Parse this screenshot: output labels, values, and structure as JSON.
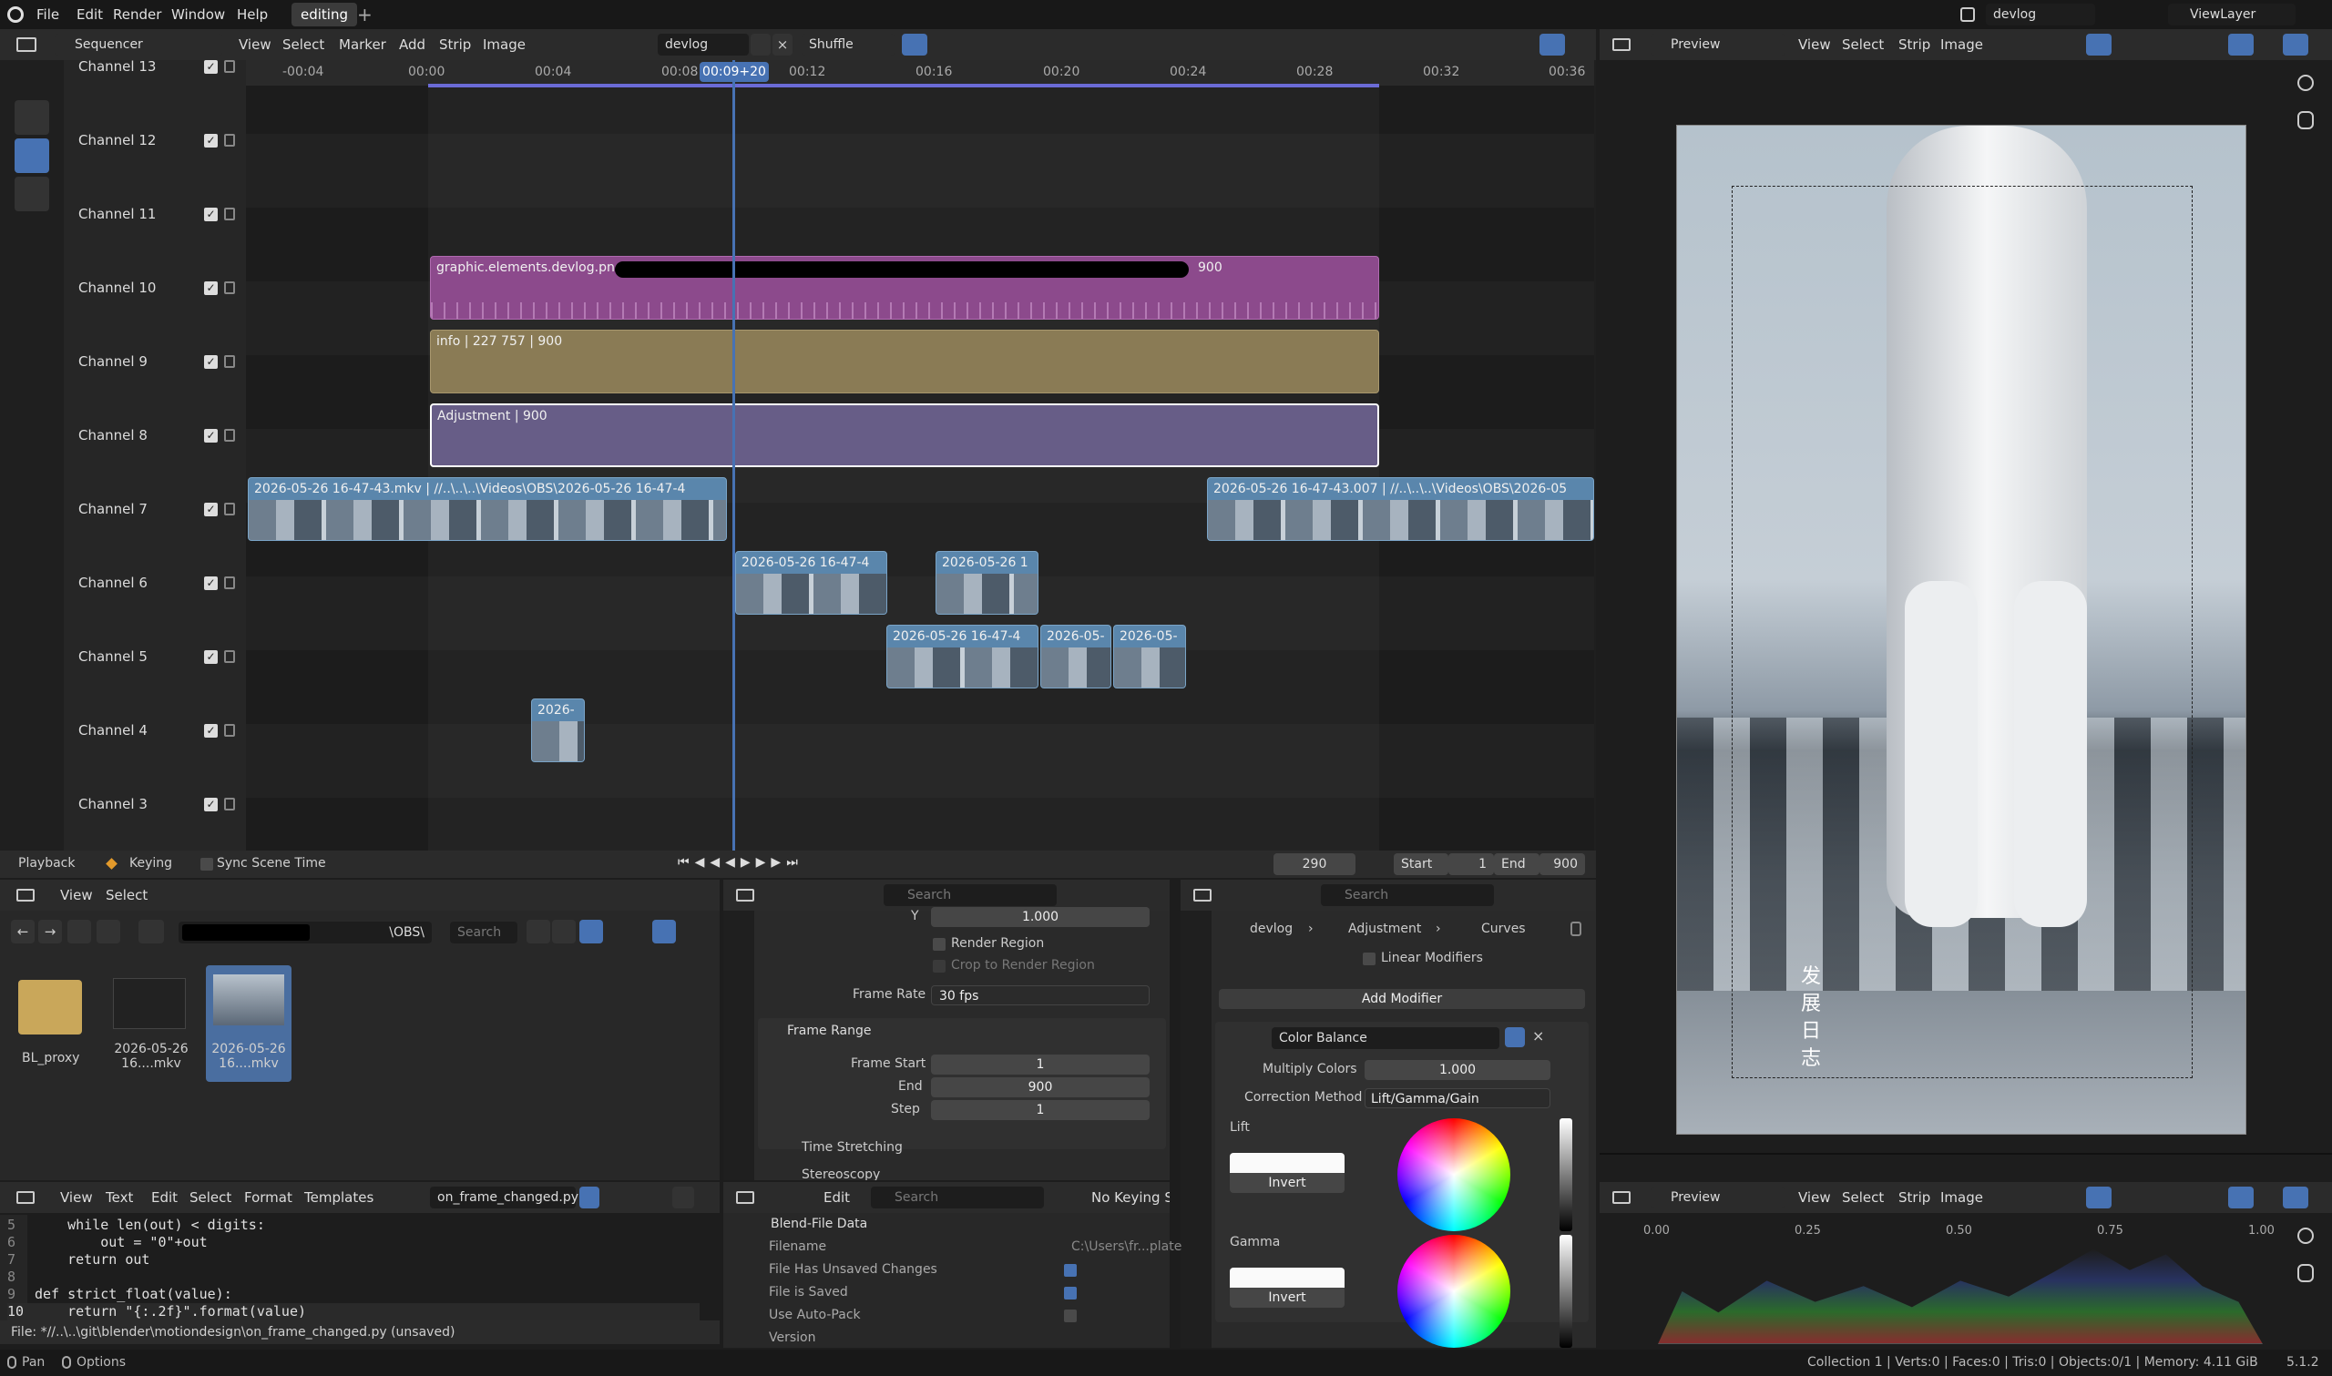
{
  "topbar": {
    "menus": [
      "File",
      "Edit",
      "Render",
      "Window",
      "Help"
    ],
    "workspace_tab": "editing",
    "scene_name": "devlog",
    "view_layer": "ViewLayer"
  },
  "sequencer": {
    "editor_type": "Sequencer",
    "menus": [
      "View",
      "Select",
      "Marker",
      "Add",
      "Strip",
      "Image"
    ],
    "scene": "devlog",
    "overlap_mode": "Shuffle",
    "current_time": "00:09+20",
    "ruler_labels": [
      "-00:04",
      "00:00",
      "00:04",
      "00:08",
      "00:12",
      "00:16",
      "00:20",
      "00:24",
      "00:28",
      "00:32",
      "00:36"
    ],
    "channels": [
      "Channel 13",
      "Channel 12",
      "Channel 11",
      "Channel 10",
      "Channel 9",
      "Channel 8",
      "Channel 7",
      "Channel 6",
      "Channel 5",
      "Channel 4",
      "Channel 3"
    ],
    "strips": {
      "image": {
        "name": "graphic.elements.devlog.png",
        "length": "900"
      },
      "info": "info | 227 757 | 900",
      "adjustment": "Adjustment | 900",
      "ch7_a": "2026-05-26 16-47-43.mkv | //..\\..\\..\\Videos\\OBS\\2026-05-26 16-47-4",
      "ch7_b": "2026-05-26 16-47-43.007 | //..\\..\\..\\Videos\\OBS\\2026-05",
      "ch6_a": "2026-05-26 16-47-4",
      "ch6_b": "2026-05-26 1",
      "ch5_a": "2026-05-26 16-47-4",
      "ch5_b": "2026-05-",
      "ch5_c": "2026-05-",
      "ch4": "2026-"
    }
  },
  "playback": {
    "playback_label": "Playback",
    "keying_label": "Keying",
    "sync_label": "Sync Scene Time",
    "frame": "290",
    "start_label": "Start",
    "start": "1",
    "end_label": "End",
    "end": "900"
  },
  "filebrowser": {
    "menus": [
      "View",
      "Select"
    ],
    "path": "\\OBS\\",
    "search_placeholder": "Search",
    "items": [
      {
        "name": "BL_proxy"
      },
      {
        "name": "2026-05-26 16....mkv"
      },
      {
        "name": "2026-05-26 16....mkv"
      }
    ]
  },
  "output_props": {
    "search_placeholder": "Search",
    "y_label": "Y",
    "y_value": "1.000",
    "render_region": "Render Region",
    "crop_region": "Crop to Render Region",
    "frame_rate_label": "Frame Rate",
    "frame_rate": "30 fps",
    "frame_range_title": "Frame Range",
    "frame_start_label": "Frame Start",
    "frame_start": "1",
    "end_label": "End",
    "end": "900",
    "step_label": "Step",
    "step": "1",
    "time_stretching": "Time Stretching",
    "stereoscopy": "Stereoscopy"
  },
  "modifier_props": {
    "search_placeholder": "Search",
    "breadcrumb": [
      "devlog",
      "Adjustment",
      "Curves"
    ],
    "linear_modifiers": "Linear Modifiers",
    "add_modifier": "Add Modifier",
    "modifier_name": "Color Balance",
    "multiply_colors_label": "Multiply Colors",
    "multiply_colors": "1.000",
    "correction_method_label": "Correction Method",
    "correction_method": "Lift/Gamma/Gain",
    "lift_label": "Lift",
    "gamma_label": "Gamma",
    "invert_label": "Invert"
  },
  "preview": {
    "editor_label": "Preview",
    "menus": [
      "View",
      "Select",
      "Strip",
      "Image"
    ],
    "vertical_text": "发展日志"
  },
  "histogram": {
    "editor_label": "Preview",
    "menus": [
      "View",
      "Select",
      "Strip",
      "Image"
    ],
    "axis_labels": [
      "0.00",
      "0.25",
      "0.50",
      "0.75",
      "1.00"
    ]
  },
  "text_editor": {
    "menus": [
      "View",
      "Text",
      "Edit",
      "Select",
      "Format",
      "Templates"
    ],
    "filename": "on_frame_changed.py",
    "lines": [
      {
        "num": "5",
        "code": "    while len(out) < digits:"
      },
      {
        "num": "6",
        "code": "        out = \"0\"+out"
      },
      {
        "num": "7",
        "code": "    return out"
      },
      {
        "num": "8",
        "code": ""
      },
      {
        "num": "9",
        "code": "def strict_float(value):"
      },
      {
        "num": "10",
        "code": "    return \"{:.2f}\".format(value)"
      }
    ],
    "status": "File: *//..\\..\\git\\blender\\motiondesign\\on_frame_changed.py (unsaved)"
  },
  "outliner": {
    "menus": [
      "Edit"
    ],
    "search_placeholder": "Search",
    "keying_set": "No Keying Set",
    "root": "Blend-File Data",
    "rows": [
      {
        "label": "Filename",
        "value": "C:\\Users\\fr...plate"
      },
      {
        "label": "File Has Unsaved Changes",
        "value": "checked"
      },
      {
        "label": "File is Saved",
        "value": "checked"
      },
      {
        "label": "Use Auto-Pack",
        "value": "unchecked"
      },
      {
        "label": "Version",
        "value": ""
      }
    ]
  },
  "statusbar": {
    "pan": "Pan",
    "options": "Options",
    "stats": "Collection 1 | Verts:0 | Faces:0 | Tris:0 | Objects:0/1 | Memory: 4.11 GiB",
    "version": "5.1.2"
  },
  "colors": {
    "image_strip": "#8c4a8c",
    "info_strip": "#8a7b55",
    "adjustment_strip": "#675d87",
    "movie_strip": "#5a86ac",
    "playhead": "#4772b3"
  }
}
